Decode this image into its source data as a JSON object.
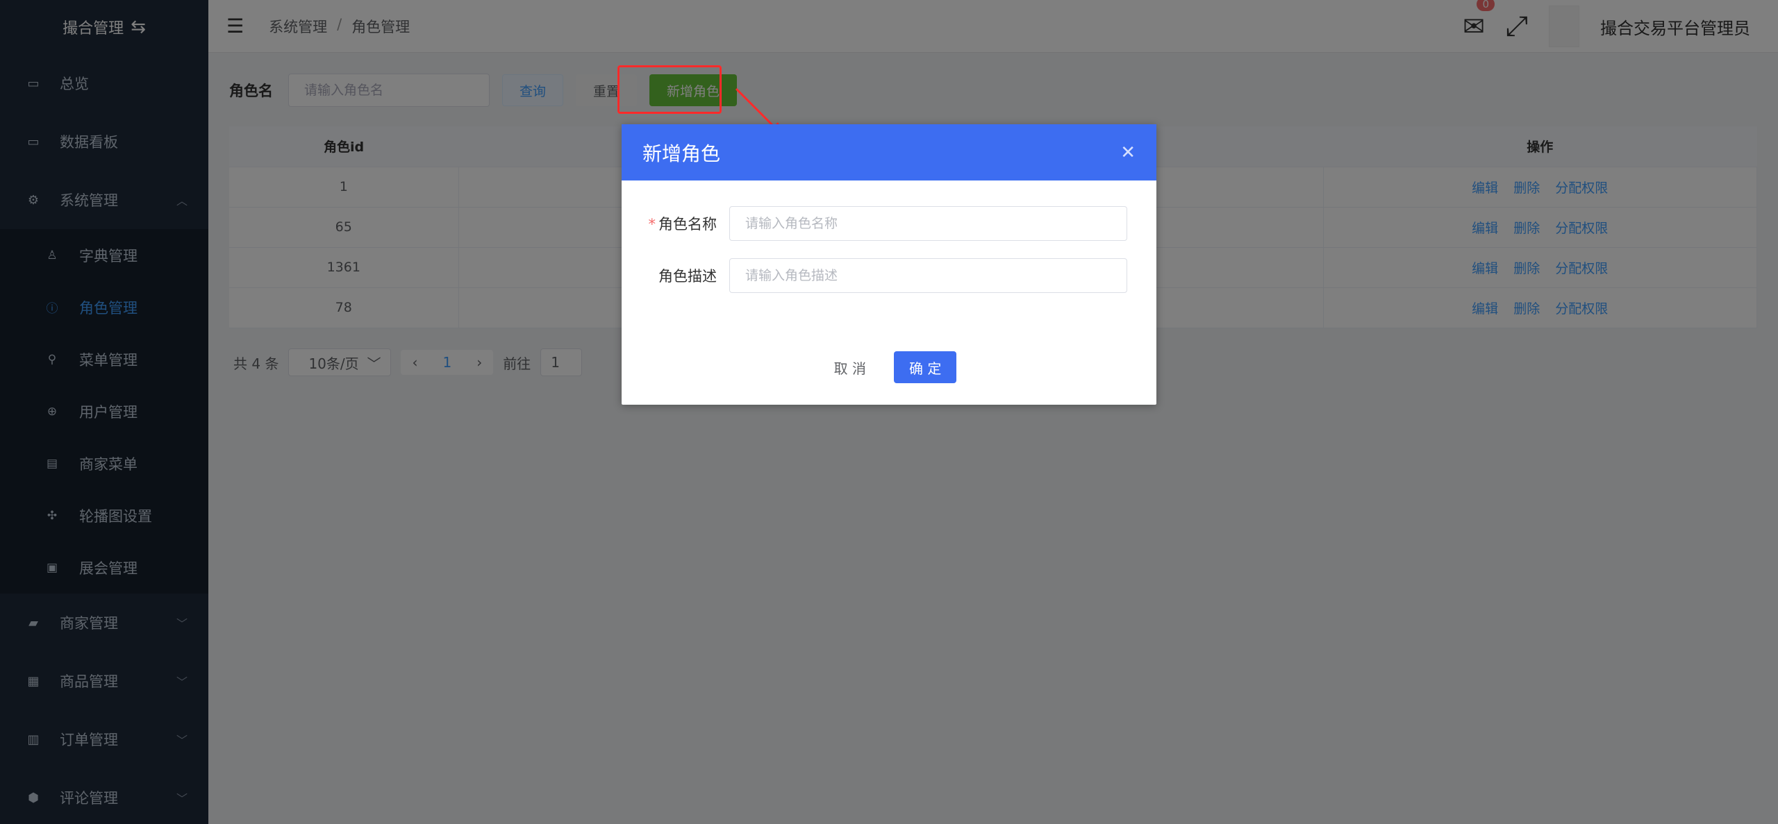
{
  "sidebar": {
    "brand": "撮合管理",
    "items": [
      {
        "label": "总览",
        "icon": "monitor-icon"
      },
      {
        "label": "数据看板",
        "icon": "monitor-icon"
      },
      {
        "label": "系统管理",
        "icon": "gear-icon"
      }
    ],
    "sub_items": [
      {
        "label": "字典管理",
        "icon": "user-icon"
      },
      {
        "label": "角色管理",
        "icon": "info-icon"
      },
      {
        "label": "菜单管理",
        "icon": "location-icon"
      },
      {
        "label": "用户管理",
        "icon": "zoom-icon"
      },
      {
        "label": "商家菜单",
        "icon": "box-icon"
      },
      {
        "label": "轮播图设置",
        "icon": "move-icon"
      },
      {
        "label": "展会管理",
        "icon": "picture-icon"
      }
    ],
    "bottom_items": [
      {
        "label": "商家管理",
        "icon": "wallet-icon"
      },
      {
        "label": "商品管理",
        "icon": "gift-icon"
      },
      {
        "label": "订单管理",
        "icon": "document-icon"
      },
      {
        "label": "评论管理",
        "icon": "shield-icon"
      }
    ]
  },
  "header": {
    "breadcrumb": [
      "系统管理",
      "角色管理"
    ],
    "mail_badge": "0",
    "user_name": "撮合交易平台管理员"
  },
  "search": {
    "label": "角色名",
    "placeholder": "请输入角色名",
    "query": "查询",
    "reset": "重置",
    "add": "新增角色"
  },
  "table": {
    "columns": [
      "角色id",
      "操作"
    ],
    "rows": [
      {
        "id": "1"
      },
      {
        "id": "65"
      },
      {
        "id": "1361"
      },
      {
        "id": "78"
      }
    ],
    "ops": [
      "编辑",
      "删除",
      "分配权限"
    ]
  },
  "pager": {
    "total": "共 4 条",
    "page_size": "10条/页",
    "current": "1",
    "goto_label": "前往",
    "goto_value": "1"
  },
  "dialog": {
    "title": "新增角色",
    "name_label": "角色名称",
    "name_placeholder": "请输入角色名称",
    "desc_label": "角色描述",
    "desc_placeholder": "请输入角色描述",
    "cancel": "取 消",
    "confirm": "确 定"
  }
}
